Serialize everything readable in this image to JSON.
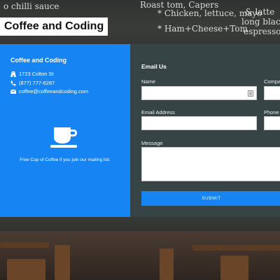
{
  "page": {
    "title": "Coffee and Coding"
  },
  "background": {
    "chalk_lines": [
      "o chilli sauce",
      "Roast tom, Capers",
      "* Chicken, lettuce, mayo",
      "& latte",
      "long black",
      "* Ham+Cheese+Tom",
      "espresso"
    ]
  },
  "info": {
    "title": "Coffee and Coding",
    "address": "1723 Colton St",
    "phone": "(877) 777-6287",
    "email": "coffee@coffeeandcoding.com",
    "promo": "Free Cup of Coffee if you join our mailing list."
  },
  "form": {
    "heading": "Email Us",
    "name_label": "Name",
    "company_label": "Compa",
    "email_label": "Email Address",
    "phone_label": "Phone",
    "message_label": "Message",
    "submit_label": "SUBMIT"
  }
}
